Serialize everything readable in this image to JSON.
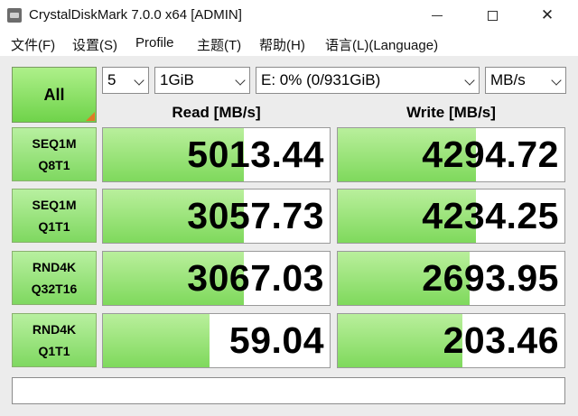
{
  "window": {
    "title": "CrystalDiskMark 7.0.0 x64 [ADMIN]",
    "close_glyph": "✕"
  },
  "menu": [
    "文件(F)",
    "设置(S)",
    "Profile",
    "主题(T)",
    "帮助(H)",
    "语言(L)(Language)"
  ],
  "controls": {
    "all_label": "All",
    "count": "5",
    "size": "1GiB",
    "drive": "E: 0% (0/931GiB)",
    "unit": "MB/s"
  },
  "headers": {
    "read": "Read [MB/s]",
    "write": "Write [MB/s]"
  },
  "tests": [
    {
      "name": "SEQ1M",
      "param": "Q8T1",
      "read": "5013.44",
      "write": "4294.72",
      "read_fill": 0.62,
      "write_fill": 0.61
    },
    {
      "name": "SEQ1M",
      "param": "Q1T1",
      "read": "3057.73",
      "write": "4234.25",
      "read_fill": 0.62,
      "write_fill": 0.61
    },
    {
      "name": "RND4K",
      "param": "Q32T16",
      "read": "3067.03",
      "write": "2693.95",
      "read_fill": 0.62,
      "write_fill": 0.58
    },
    {
      "name": "RND4K",
      "param": "Q1T1",
      "read": "59.04",
      "write": "203.46",
      "read_fill": 0.47,
      "write_fill": 0.55
    }
  ],
  "comment": "",
  "colors": {
    "bar_top": "#b9ef9c",
    "bar_bottom": "#7fd95c",
    "accent_corner": "#e07a28"
  }
}
